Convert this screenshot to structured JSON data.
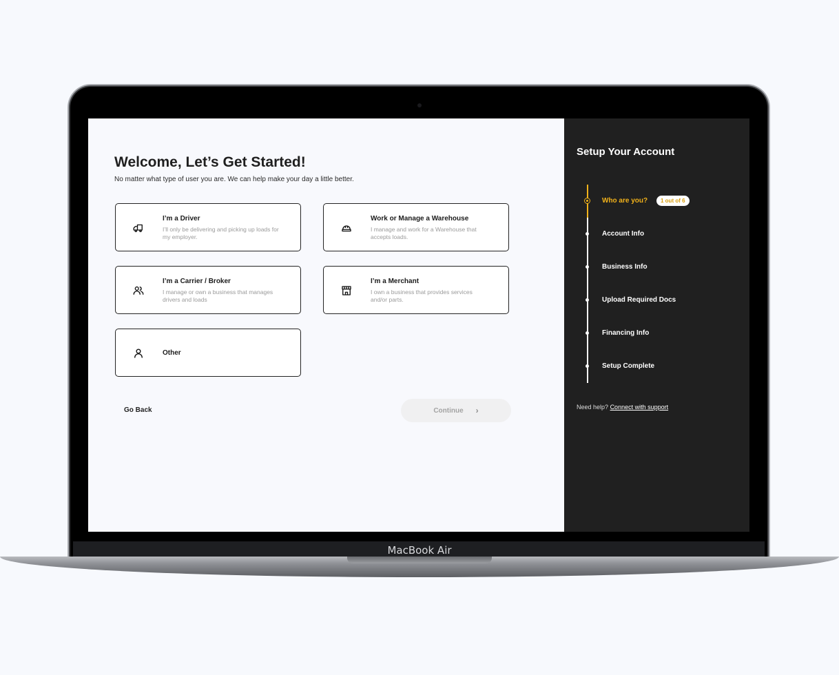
{
  "device": {
    "label": "MacBook Air"
  },
  "main": {
    "title": "Welcome, Let’s Get Started!",
    "subtitle": "No matter what type of user you are. We can help make your day a little better.",
    "options": [
      {
        "title": "I’m a Driver",
        "description": "I’ll only  be delivering and picking up loads for my employer.",
        "icon": "truck-icon"
      },
      {
        "title": "Work or Manage a Warehouse",
        "description": "I manage and work for a Warehouse that accepts loads.",
        "icon": "hard-hat-icon"
      },
      {
        "title": "I’m a Carrier / Broker",
        "description": "I manage or own a business that manages drivers and loads",
        "icon": "users-icon"
      },
      {
        "title": "I’m a Merchant",
        "description": "I own a business that provides services and/or parts.",
        "icon": "storefront-icon"
      },
      {
        "title": "Other",
        "description": "",
        "icon": "user-icon"
      }
    ],
    "go_back_label": "Go Back",
    "continue_label": "Continue"
  },
  "sidebar": {
    "title": "Setup Your Account",
    "steps": [
      {
        "label": "Who are you?",
        "active": true
      },
      {
        "label": "Account Info"
      },
      {
        "label": "Business Info"
      },
      {
        "label": "Upload Required Docs"
      },
      {
        "label": "Financing Info"
      },
      {
        "label": "Setup Complete"
      }
    ],
    "progress_badge": "1 out of 6",
    "help_text": "Need help?",
    "help_link": "Connect with support",
    "accent_color": "#f2b21a"
  }
}
